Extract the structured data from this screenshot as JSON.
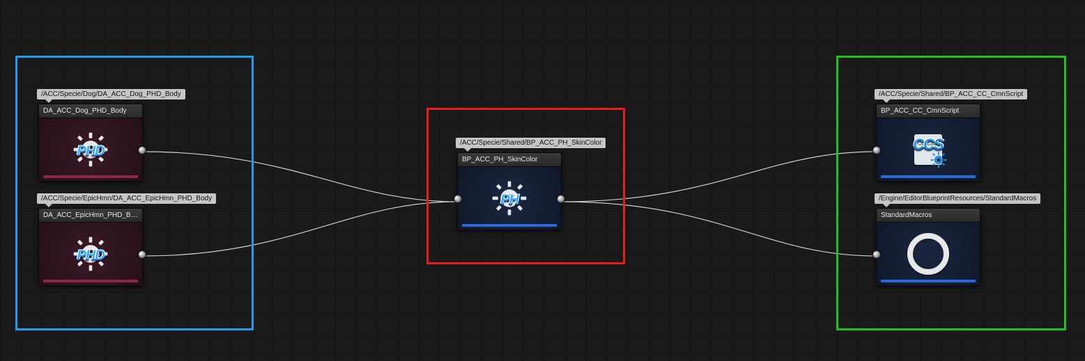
{
  "groups": {
    "blue": {
      "color": "#1e9ef2"
    },
    "red": {
      "color": "#e81e1e"
    },
    "green": {
      "color": "#1ec31e"
    }
  },
  "nodes": {
    "n1": {
      "tooltip": "/ACC/Specie/Dog/DA_ACC_Dog_PHD_Body",
      "title": "DA_ACC_Dog_PHD_Body",
      "badge": "PHD",
      "thumb_bg": "maroon",
      "underline": "#8a2a46"
    },
    "n2": {
      "tooltip": "/ACC/Specie/EpicHmn/DA_ACC_EpicHmn_PHD_Body",
      "title": "DA_ACC_EpicHmn_PHD_Body",
      "badge": "PHD",
      "thumb_bg": "maroon",
      "underline": "#8a2a46"
    },
    "n3": {
      "tooltip": "/ACC/Specie/Shared/BP_ACC_PH_SkinColor",
      "title": "BP_ACC_PH_SkinColor",
      "badge": "PH",
      "thumb_bg": "navy",
      "underline": "#2a6ad8"
    },
    "n4": {
      "tooltip": "/ACC/Specie/Shared/BP_ACC_CC_CmnScript",
      "title": "BP_ACC_CC_CmnScript",
      "badge": "CCS",
      "thumb_bg": "navy",
      "underline": "#2a6ad8"
    },
    "n5": {
      "tooltip": "/Engine/EditorBlueprintResources/StandardMacros",
      "title": "StandardMacros",
      "badge": "ring",
      "thumb_bg": "navy",
      "underline": "#2a6ad8"
    }
  }
}
